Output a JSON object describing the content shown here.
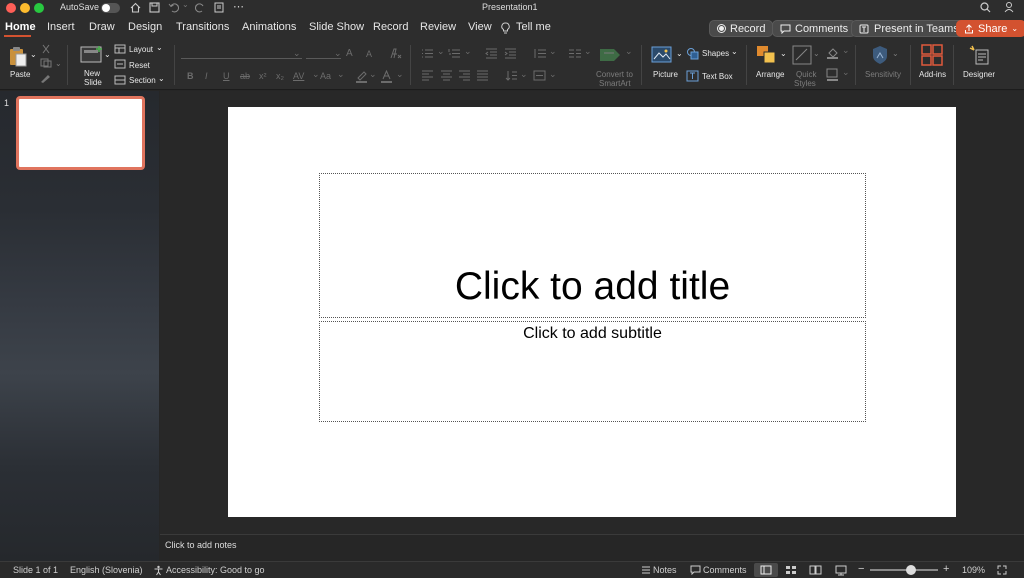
{
  "titlebar": {
    "autosave_label": "AutoSave",
    "document_title": "Presentation1",
    "more": "⋯"
  },
  "tabs": [
    "Home",
    "Insert",
    "Draw",
    "Design",
    "Transitions",
    "Animations",
    "Slide Show",
    "Record",
    "Review",
    "View"
  ],
  "tell_me": "Tell me",
  "actions": {
    "record": "Record",
    "comments": "Comments",
    "present": "Present in Teams",
    "share": "Share"
  },
  "ribbon": {
    "paste": "Paste",
    "new_slide": [
      "New",
      "Slide"
    ],
    "layout": "Layout",
    "reset": "Reset",
    "section": "Section",
    "convert_smartart": [
      "Convert to",
      "SmartArt"
    ],
    "picture": "Picture",
    "shapes": "Shapes",
    "text_box": "Text Box",
    "arrange": "Arrange",
    "quick_styles": [
      "Quick",
      "Styles"
    ],
    "sensitivity": "Sensitivity",
    "addins": "Add-ins",
    "designer": "Designer",
    "font_glyphs": {
      "bold": "B",
      "italic": "I",
      "underline": "U",
      "strike": "ab",
      "superscript": "x²",
      "subscript": "x₂",
      "grow": "A",
      "shrink": "A",
      "case": "Aa",
      "spacing": "AV"
    }
  },
  "thumbnail_number": "1",
  "slide": {
    "title_placeholder": "Click to add title",
    "subtitle_placeholder": "Click to add subtitle"
  },
  "notes_placeholder": "Click to add notes",
  "status": {
    "slide_count": "Slide 1 of 1",
    "language": "English (Slovenia)",
    "accessibility": "Accessibility: Good to go",
    "notes": "Notes",
    "comments": "Comments",
    "zoom_minus": "−",
    "zoom_plus": "+",
    "zoom": "109%"
  },
  "zoom_level": 0.6,
  "colors": {
    "accent": "#d35230",
    "thumbnail_border": "#e0745e",
    "close": "#ff5f57",
    "minimize": "#febc2e",
    "maximize": "#28c840",
    "tab_underline": "#d35230"
  }
}
